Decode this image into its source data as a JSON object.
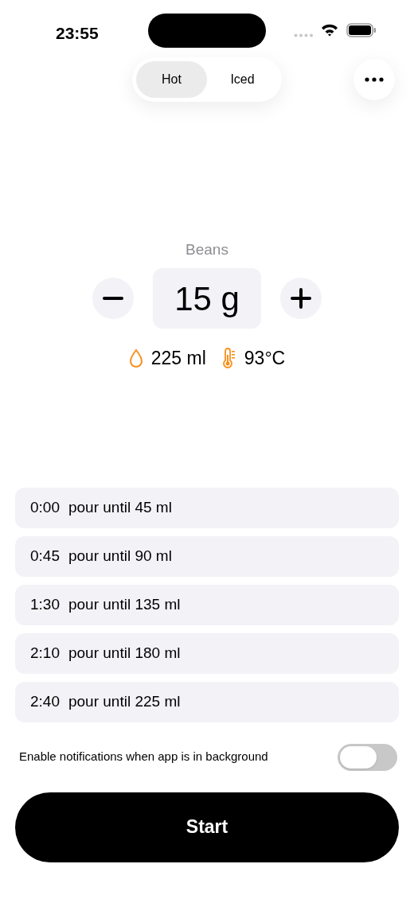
{
  "status_bar": {
    "time": "23:55"
  },
  "segments": [
    {
      "label": "Hot",
      "selected": true
    },
    {
      "label": "Iced",
      "selected": false
    }
  ],
  "beans": {
    "label": "Beans",
    "value": "15 g"
  },
  "info": {
    "water": "225 ml",
    "temperature": "93°C"
  },
  "steps": [
    {
      "time": "0:00",
      "text": "pour until 45 ml"
    },
    {
      "time": "0:45",
      "text": "pour until 90 ml"
    },
    {
      "time": "1:30",
      "text": "pour until 135 ml"
    },
    {
      "time": "2:10",
      "text": "pour until 180 ml"
    },
    {
      "time": "2:40",
      "text": "pour until 225 ml"
    }
  ],
  "notifications": {
    "label": "Enable notifications when app is in background",
    "on": false
  },
  "start_button": "Start"
}
